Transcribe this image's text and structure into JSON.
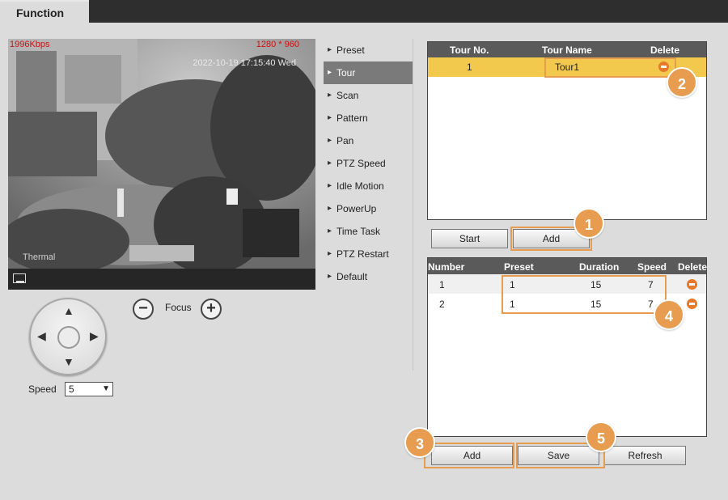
{
  "header": {
    "tab_label": "Function"
  },
  "video": {
    "bitrate": "1996Kbps",
    "resolution": "1280 * 960",
    "timestamp": "2022-10-19 17:15:40 Wed",
    "channel_label": "Thermal"
  },
  "ptz": {
    "focus_label": "Focus",
    "minus": "−",
    "plus": "+",
    "speed_label": "Speed",
    "speed_value": "5",
    "up": "▲",
    "down": "▼",
    "left": "◀",
    "right": "▶"
  },
  "menu": {
    "items": [
      "Preset",
      "Tour",
      "Scan",
      "Pattern",
      "Pan",
      "PTZ Speed",
      "Idle Motion",
      "PowerUp",
      "Time Task",
      "PTZ Restart",
      "Default"
    ],
    "active": "Tour"
  },
  "tour_table": {
    "headers": {
      "no": "Tour No.",
      "name": "Tour Name",
      "delete": "Delete"
    },
    "rows": [
      {
        "no": "1",
        "name": "Tour1"
      }
    ]
  },
  "tour_buttons": {
    "start": "Start",
    "add": "Add"
  },
  "preset_table": {
    "headers": {
      "number": "Number",
      "preset": "Preset",
      "duration": "Duration",
      "speed": "Speed",
      "delete": "Delete"
    },
    "rows": [
      {
        "number": "1",
        "preset": "1",
        "duration": "15",
        "speed": "7"
      },
      {
        "number": "2",
        "preset": "1",
        "duration": "15",
        "speed": "7"
      }
    ]
  },
  "bottom_buttons": {
    "add": "Add",
    "save": "Save",
    "refresh": "Refresh"
  },
  "callouts": [
    "1",
    "2",
    "3",
    "4",
    "5"
  ],
  "colors": {
    "callout": "#e89c50",
    "selected_row": "#f2c94c",
    "delete_icon": "#e8792a",
    "overlay_red": "#d01010"
  }
}
